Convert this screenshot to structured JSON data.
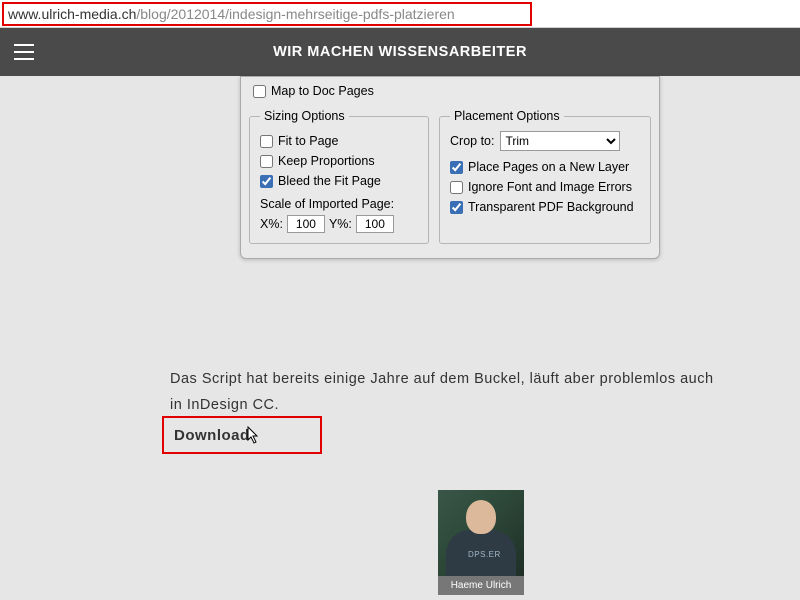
{
  "url": {
    "host": "www.ulrich-media.ch",
    "path": "/blog/2012014/indesign-mehrseitige-pdfs-platzieren"
  },
  "topbar": {
    "title": "WIR MACHEN WISSENSARBEITER"
  },
  "dialog": {
    "map_to_doc": "Map to Doc Pages",
    "sizing": {
      "legend": "Sizing Options",
      "fit_to_page": "Fit to Page",
      "keep_proportions": "Keep Proportions",
      "bleed_fit_page": "Bleed the Fit Page",
      "scale_label": "Scale of Imported Page:",
      "x_label": "X%:",
      "x_val": "100",
      "y_label": "Y%:",
      "y_val": "100"
    },
    "placement": {
      "legend": "Placement Options",
      "crop_label": "Crop to:",
      "crop_value": "Trim",
      "new_layer": "Place Pages on a New Layer",
      "ignore_errors": "Ignore Font and Image Errors",
      "transparent_bg": "Transparent PDF Background"
    }
  },
  "article": {
    "paragraph": "Das Script hat bereits einige Jahre auf dem Buckel, läuft aber problemlos auch in InDesign CC.",
    "download_label": "Download"
  },
  "author": {
    "name": "Haeme Ulrich",
    "shirt": "DPS.ER"
  }
}
